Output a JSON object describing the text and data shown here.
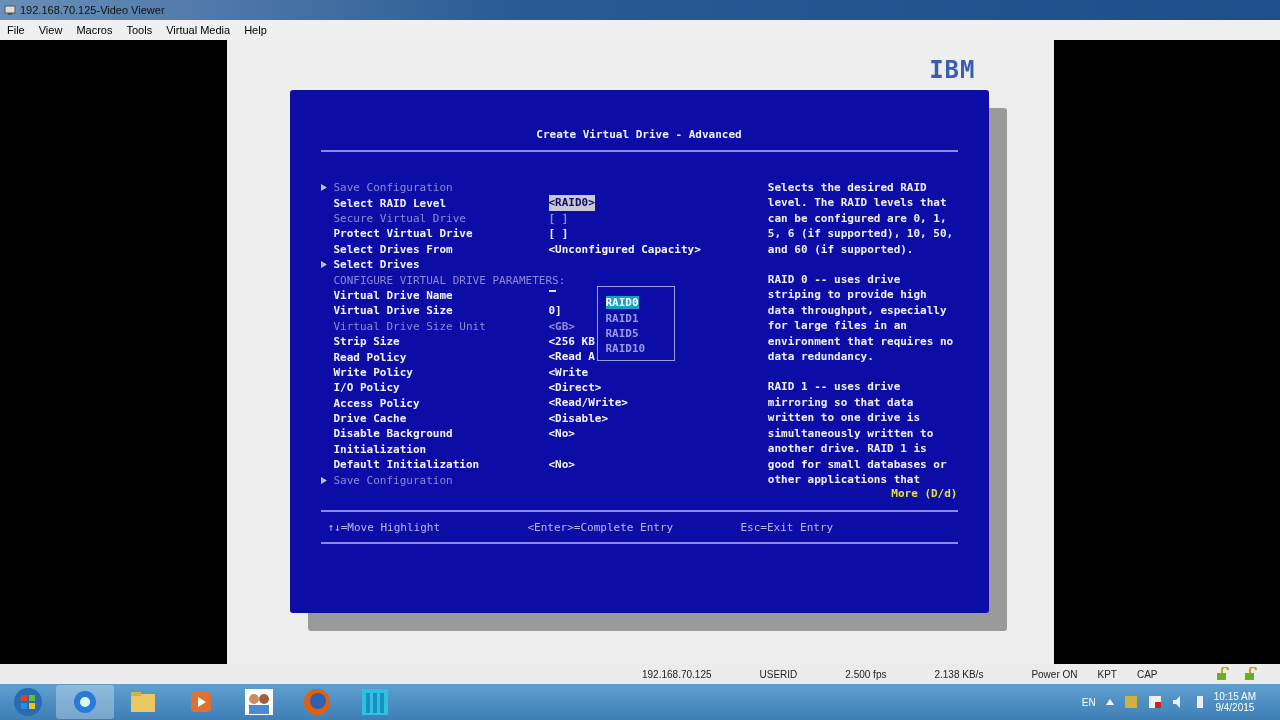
{
  "window": {
    "title": "192.168.70.125-Video Viewer"
  },
  "menu": [
    "File",
    "View",
    "Macros",
    "Tools",
    "Virtual Media",
    "Help"
  ],
  "logo": "IBM",
  "dialog": {
    "title": "Create Virtual Drive - Advanced",
    "rows": [
      {
        "kind": "submenu",
        "label": "Save Configuration",
        "value": "",
        "disabled": true,
        "highlighted": false
      },
      {
        "kind": "item",
        "label": "Select RAID Level",
        "value": "<RAID0>",
        "disabled": false,
        "highlighted": true
      },
      {
        "kind": "item",
        "label": "Secure Virtual Drive",
        "value": "[ ]",
        "disabled": true,
        "highlighted": false
      },
      {
        "kind": "item",
        "label": "Protect Virtual Drive",
        "value": "[ ]",
        "disabled": false,
        "highlighted": false
      },
      {
        "kind": "item",
        "label": "Select Drives From",
        "value": "<Unconfigured Capacity>",
        "disabled": false,
        "highlighted": false
      },
      {
        "kind": "submenu",
        "label": "Select Drives",
        "value": "",
        "disabled": false,
        "highlighted": false
      },
      {
        "kind": "item",
        "label": "CONFIGURE VIRTUAL DRIVE PARAMETERS:",
        "value": "",
        "disabled": true,
        "highlighted": false
      },
      {
        "kind": "input",
        "label": "Virtual Drive Name",
        "value": "",
        "disabled": false,
        "highlighted": false
      },
      {
        "kind": "item",
        "label": "Virtual Drive Size",
        "value": "0]",
        "disabled": false,
        "highlighted": false
      },
      {
        "kind": "item",
        "label": "Virtual Drive Size Unit",
        "value": "<GB>",
        "disabled": true,
        "highlighted": false
      },
      {
        "kind": "item",
        "label": "Strip Size",
        "value": "<256 KB",
        "disabled": false,
        "highlighted": false
      },
      {
        "kind": "item",
        "label": "Read Policy",
        "value": "<Read A",
        "disabled": false,
        "highlighted": false
      },
      {
        "kind": "item",
        "label": "Write Policy",
        "value": "<Write",
        "disabled": false,
        "highlighted": false
      },
      {
        "kind": "item",
        "label": "I/O Policy",
        "value": "<Direct>",
        "disabled": false,
        "highlighted": false
      },
      {
        "kind": "item",
        "label": "Access Policy",
        "value": "<Read/Write>",
        "disabled": false,
        "highlighted": false
      },
      {
        "kind": "item",
        "label": "Drive Cache",
        "value": "<Disable>",
        "disabled": false,
        "highlighted": false
      },
      {
        "kind": "item",
        "label": "Disable Background",
        "value": "<No>",
        "disabled": false,
        "highlighted": false
      },
      {
        "kind": "item",
        "label": "Initialization",
        "value": "",
        "disabled": false,
        "highlighted": false
      },
      {
        "kind": "item",
        "label": "Default Initialization",
        "value": "<No>",
        "disabled": false,
        "highlighted": false
      },
      {
        "kind": "submenu",
        "label": "Save Configuration",
        "value": "",
        "disabled": true,
        "highlighted": false
      }
    ],
    "popup": [
      {
        "label": "RAID0",
        "selected": true
      },
      {
        "label": "RAID1",
        "selected": false
      },
      {
        "label": "RAID5",
        "selected": false
      },
      {
        "label": "RAID10",
        "selected": false
      }
    ],
    "help": [
      "Selects the desired RAID\nlevel. The RAID levels that\ncan be configured are 0, 1,\n5, 6 (if supported), 10, 50,\nand 60 (if supported).",
      "RAID 0 -- uses drive\nstriping to provide high\ndata throughput, especially\nfor large files in an\nenvironment that requires no\ndata redundancy.",
      "RAID 1 -- uses drive\nmirroring so that data\nwritten to one drive is\nsimultaneously written to\nanother drive. RAID 1 is\ngood for small databases or\nother applications that"
    ],
    "more": "More (D/d)",
    "footer": [
      "↑↓=Move Highlight",
      "<Enter>=Complete Entry",
      "Esc=Exit Entry"
    ]
  },
  "status_bar": [
    "192.168.70.125",
    "USERID",
    "2.500 fps",
    "2.138 KB/s",
    "Power ON",
    "KPT",
    "CAP"
  ],
  "tray": {
    "language": "EN",
    "time": "10:15 AM",
    "date": "9/4/2015"
  }
}
